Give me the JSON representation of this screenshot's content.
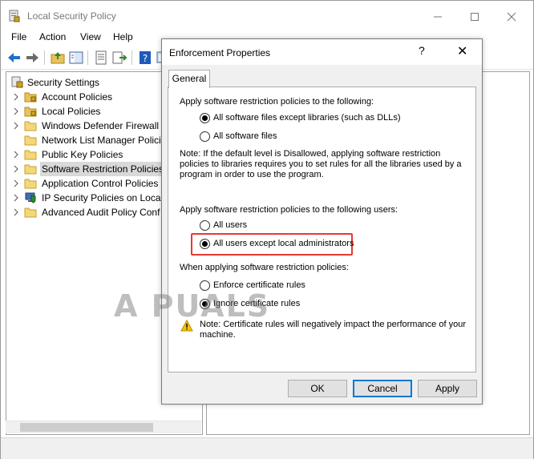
{
  "window": {
    "title": "Local Security Policy",
    "minimize_icon": "minimize-icon",
    "maximize_icon": "maximize-icon",
    "close_icon": "close-icon"
  },
  "menu": [
    "File",
    "Action",
    "View",
    "Help"
  ],
  "toolbar": {
    "icons": [
      "back-arrow-icon",
      "forward-arrow-icon",
      "up-folder-icon",
      "show-hide-tree-icon",
      "properties-icon",
      "export-list-icon",
      "help-icon",
      "console-icon"
    ]
  },
  "tree": {
    "root": "Security Settings",
    "items": [
      {
        "label": "Account Policies",
        "icon": "locked-folder-icon"
      },
      {
        "label": "Local Policies",
        "icon": "locked-folder-icon"
      },
      {
        "label": "Windows Defender Firewall w",
        "icon": "folder-icon"
      },
      {
        "label": "Network List Manager Polici",
        "icon": "folder-icon"
      },
      {
        "label": "Public Key Policies",
        "icon": "folder-icon"
      },
      {
        "label": "Software Restriction Policies",
        "icon": "folder-icon",
        "selected": true
      },
      {
        "label": "Application Control Policies",
        "icon": "folder-icon"
      },
      {
        "label": "IP Security Policies on Local",
        "icon": "shield-computer-icon"
      },
      {
        "label": "Advanced Audit Policy Conf",
        "icon": "folder-icon"
      }
    ]
  },
  "dialog": {
    "title": "Enforcement Properties",
    "help": "?",
    "close": "✕",
    "tab": "General",
    "section1_heading": "Apply software restriction policies to the following:",
    "section1_options": [
      "All software files except libraries (such as DLLs)",
      "All software files"
    ],
    "section1_selected": 0,
    "note1": "Note:  If the default level is Disallowed, applying software restriction policies to libraries requires you to set rules for all the libraries used by a program in order to use the program.",
    "section2_heading": "Apply software restriction policies to the following users:",
    "section2_options": [
      "All users",
      "All users except local administrators"
    ],
    "section2_selected": 1,
    "section3_heading": "When applying software restriction policies:",
    "section3_options": [
      "Enforce certificate rules",
      "Ignore certificate rules"
    ],
    "section3_selected": 1,
    "note2": "Note:  Certificate rules will negatively impact the performance of your machine.",
    "buttons": {
      "ok": "OK",
      "cancel": "Cancel",
      "apply": "Apply"
    },
    "highlight_color": "#e53935"
  },
  "watermark": "A PUALS"
}
